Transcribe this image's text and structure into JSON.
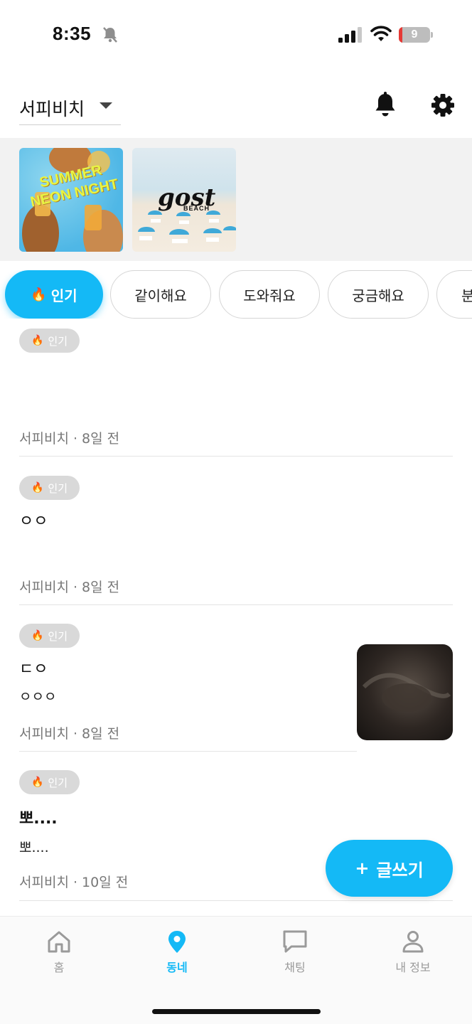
{
  "status_bar": {
    "time": "8:35",
    "battery_level": "9",
    "battery_fraction": 0.09,
    "battery_color": "#e53935"
  },
  "header": {
    "location": "서피비치",
    "icons": [
      "bell-icon",
      "gear-icon"
    ]
  },
  "banners": [
    {
      "text": "SUMMER NEON NIGHT"
    },
    {
      "logo": "gost",
      "sub": "BEACH"
    }
  ],
  "categories": [
    {
      "label": "인기",
      "icon": "🔥",
      "active": true
    },
    {
      "label": "같이해요",
      "active": false
    },
    {
      "label": "도와줘요",
      "active": false
    },
    {
      "label": "궁금해요",
      "active": false
    },
    {
      "label": "분",
      "active": false
    }
  ],
  "posts": [
    {
      "badge": "인기",
      "title": "",
      "body": "",
      "meta": "서피비치 · 8일 전",
      "has_thumbnail": false
    },
    {
      "badge": "인기",
      "title": "ㅇㅇ",
      "body": "",
      "meta": "서피비치 · 8일 전",
      "has_thumbnail": false
    },
    {
      "badge": "인기",
      "title": "ㄷㅇ",
      "body": "ㅇㅇㅇ",
      "meta": "서피비치 · 8일 전",
      "has_thumbnail": true
    },
    {
      "badge": "인기",
      "title": "뽀....",
      "body": "뽀....",
      "meta": "서피비치 · 10일 전",
      "has_thumbnail": false
    }
  ],
  "fab": {
    "label": "글쓰기"
  },
  "bottom_nav": [
    {
      "label": "홈",
      "icon": "home-icon",
      "active": false
    },
    {
      "label": "동네",
      "icon": "location-pin-icon",
      "active": true
    },
    {
      "label": "채팅",
      "icon": "chat-icon",
      "active": false
    },
    {
      "label": "내 정보",
      "icon": "person-icon",
      "active": false
    }
  ],
  "colors": {
    "accent": "#14b9f6",
    "badge_bg": "#d9d9d9",
    "meta_text": "#777777"
  }
}
